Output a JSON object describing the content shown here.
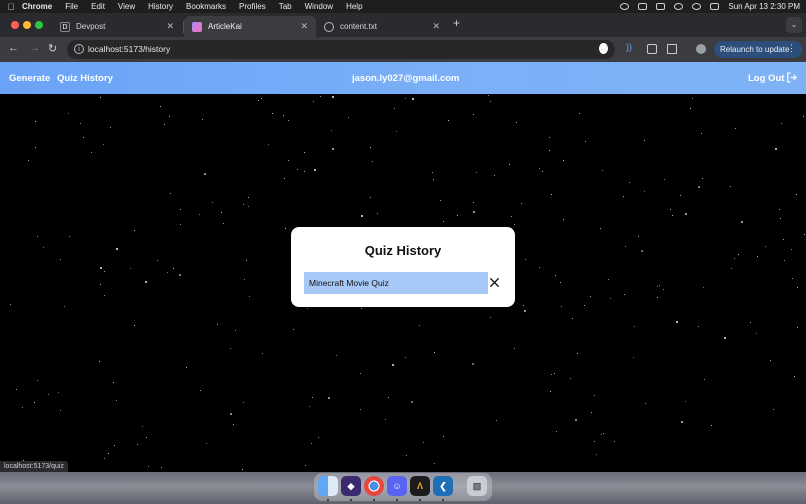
{
  "menubar": {
    "app": "Chrome",
    "items": [
      "File",
      "Edit",
      "View",
      "History",
      "Bookmarks",
      "Profiles",
      "Tab",
      "Window",
      "Help"
    ],
    "datetime": "Sun Apr 13  2:30 PM"
  },
  "tabs": [
    {
      "title": "Devpost",
      "favicon": "devpost-icon"
    },
    {
      "title": "ArticleKai",
      "favicon": "articlekai-icon"
    },
    {
      "title": "content.txt",
      "favicon": "globe-icon"
    }
  ],
  "address_bar": {
    "url": "localhost:5173/history",
    "relaunch_label": "Relaunch to update"
  },
  "navbar": {
    "generate_label": "Generate",
    "history_label": "Quiz History",
    "user_email": "jason.ly027@gmail.com",
    "logout_label": "Log Out"
  },
  "modal": {
    "title": "Quiz History",
    "quizzes": [
      {
        "name": "Minecraft Movie Quiz"
      }
    ]
  },
  "statusbar": {
    "hover_url": "localhost:5173/quiz"
  },
  "dock": {
    "apps": [
      "finder-icon",
      "ai-app-icon",
      "chrome-icon",
      "discord-icon",
      "articlekai-icon",
      "vscode-icon",
      "trash-icon"
    ]
  },
  "colors": {
    "navbar_gradient_start": "#6aa3f7",
    "navbar_gradient_end": "#7fb2f5",
    "quiz_item_bg": "#a7c9f8",
    "page_bg": "#000000"
  }
}
